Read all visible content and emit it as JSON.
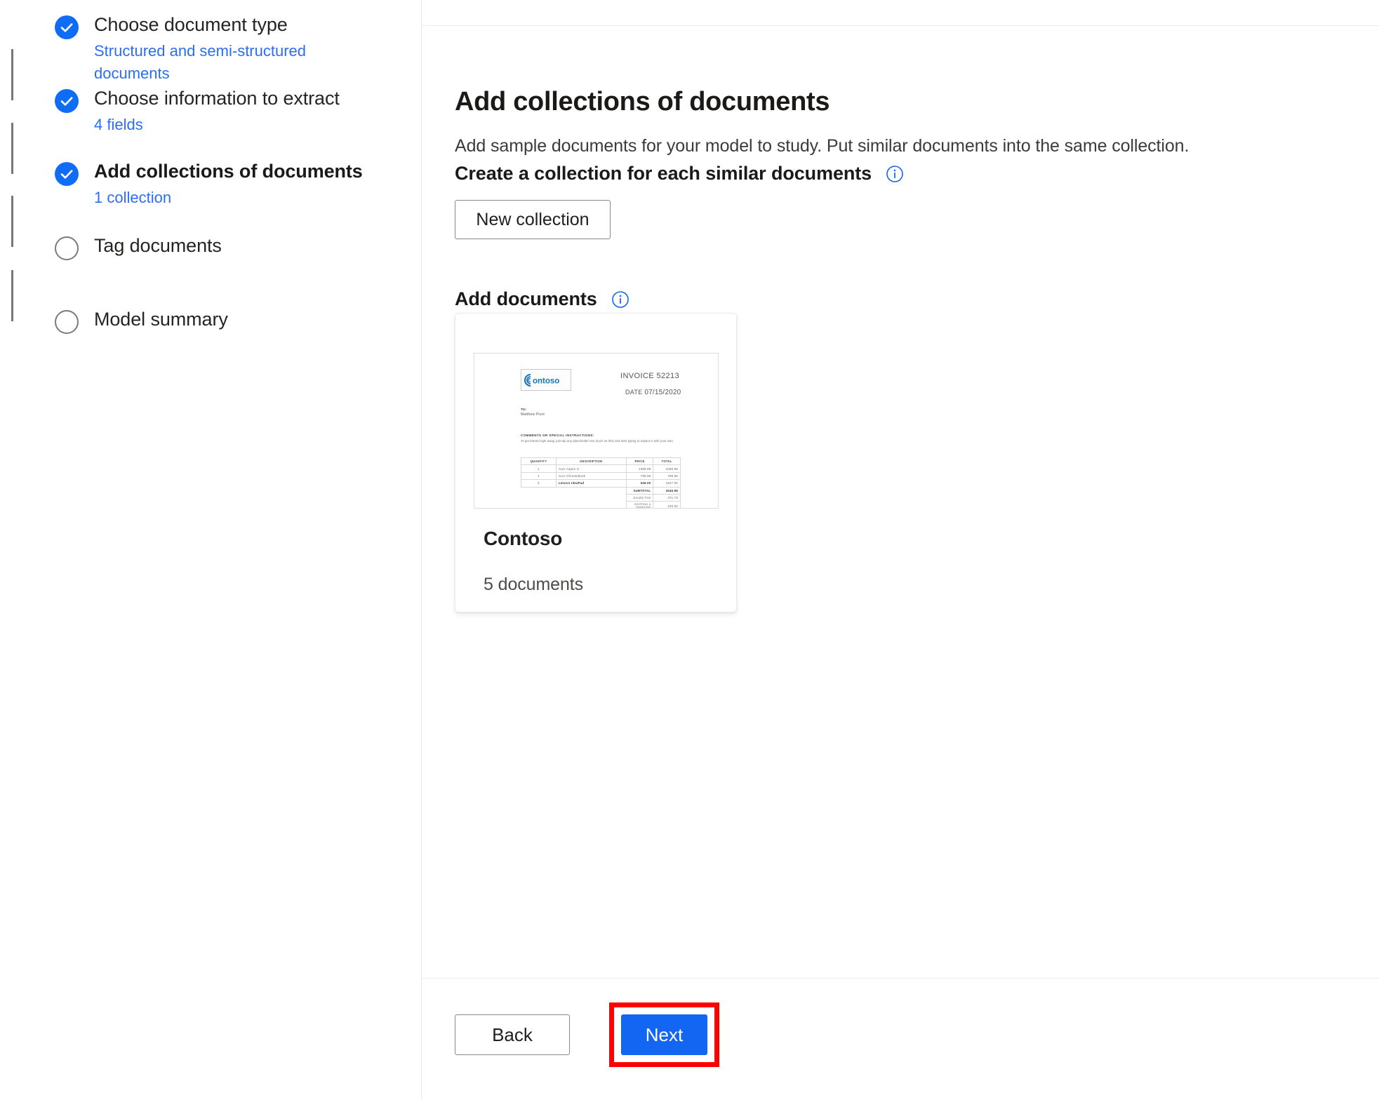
{
  "wizard": {
    "steps": [
      {
        "title": "Choose document type",
        "sub": "Structured and semi-structured documents",
        "state": "done",
        "current": false
      },
      {
        "title": "Choose information to extract",
        "sub": "4 fields",
        "state": "done",
        "current": false
      },
      {
        "title": "Add collections of documents",
        "sub": "1 collection",
        "state": "done",
        "current": true
      },
      {
        "title": "Tag documents",
        "sub": "",
        "state": "todo",
        "current": false
      },
      {
        "title": "Model summary",
        "sub": "",
        "state": "todo",
        "current": false
      }
    ]
  },
  "main": {
    "title": "Add collections of documents",
    "subtitle": "Add sample documents for your model to study. Put similar documents into the same collection.",
    "create_collection_label": "Create a collection for each similar documents",
    "create_collection_info_icon": "info-icon",
    "new_collection_label": "New collection",
    "add_documents_label": "Add documents",
    "add_documents_info_icon": "info-icon"
  },
  "collection_card": {
    "name": "Contoso",
    "document_count_label": "5 documents",
    "thumbnail": {
      "logo_text": "ontoso",
      "invoice_label": "INVOICE  52213",
      "date_label": "DATE",
      "date_value": "07/15/2020",
      "to_label": "TO:",
      "to_value": "Matthew Picot",
      "comments_label": "COMMENTS OR SPECIAL INSTRUCTIONS:",
      "comments_body": "To get started right away, just tap any placeholder text (such as this) and start typing to replace it with your own.",
      "table": {
        "headers": [
          "QUANTITY",
          "DESCRIPTION",
          "PRICE",
          "TOTAL"
        ],
        "rows": [
          [
            "1",
            "Acer Aspire U",
            "1099.99",
            "1099.99"
          ],
          [
            "1",
            "Acer Chromebook",
            "799.99",
            "799.99"
          ],
          [
            "3",
            "Lenovo IdeaPad",
            "549.00",
            "1647.00"
          ]
        ],
        "totals": [
          [
            "SUBTOTAL",
            "3546.98"
          ],
          [
            "SALES TAX",
            "371.73"
          ],
          [
            "SHIPPING & HANDLING",
            "100.00"
          ]
        ]
      }
    }
  },
  "footer": {
    "back_label": "Back",
    "next_label": "Next",
    "next_highlight_color": "#ff0000"
  },
  "colors": {
    "accent": "#0f6cf5",
    "primary_button": "#1266f1",
    "link": "#2b6ef5",
    "highlight": "#ff0000"
  }
}
